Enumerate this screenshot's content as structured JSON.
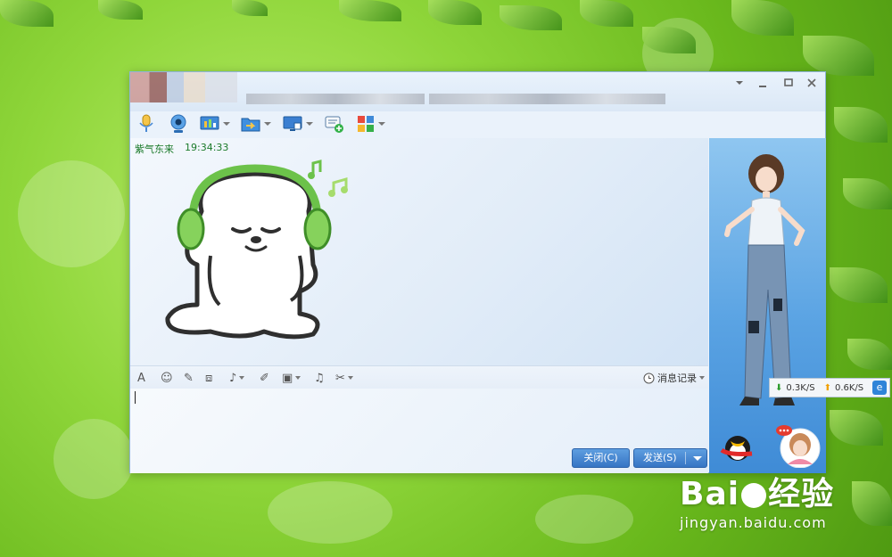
{
  "desktop": {
    "watermark_logo": "Bai",
    "watermark_logo_suffix": "经验",
    "watermark_url": "jingyan.baidu.com"
  },
  "window": {
    "title": "",
    "controls": [
      "menu",
      "minimize",
      "maximize",
      "close"
    ]
  },
  "toolbar": {
    "items": [
      {
        "name": "voice-call",
        "icon": "microphone-icon",
        "has_dropdown": false
      },
      {
        "name": "video-call",
        "icon": "webcam-icon",
        "has_dropdown": false
      },
      {
        "name": "remote-assist",
        "icon": "screen-share-icon",
        "has_dropdown": true
      },
      {
        "name": "send-file",
        "icon": "folder-transfer-icon",
        "has_dropdown": true
      },
      {
        "name": "remote-desktop",
        "icon": "remote-desktop-icon",
        "has_dropdown": true
      },
      {
        "name": "create-discussion",
        "icon": "chat-add-icon",
        "has_dropdown": false
      },
      {
        "name": "apps",
        "icon": "app-grid-icon",
        "has_dropdown": true
      }
    ]
  },
  "chat": {
    "messages": [
      {
        "sender": "紫气东来",
        "time": "19:34:33",
        "content_type": "sticker",
        "sticker": "dog-with-headphones"
      }
    ]
  },
  "format_bar": {
    "items": [
      {
        "name": "font",
        "glyph": "A",
        "icon": "font-icon",
        "has_dropdown": false
      },
      {
        "name": "emoji",
        "glyph": "☺",
        "icon": "smiley-icon",
        "has_dropdown": false
      },
      {
        "name": "magic-emoji",
        "glyph": "✎",
        "icon": "wand-icon",
        "has_dropdown": false
      },
      {
        "name": "shake",
        "glyph": "⧈",
        "icon": "shake-icon",
        "has_dropdown": false
      },
      {
        "name": "voice-message",
        "glyph": "♪",
        "icon": "mic-small-icon",
        "has_dropdown": true
      },
      {
        "name": "note",
        "glyph": "✐",
        "icon": "edit-icon",
        "has_dropdown": false
      },
      {
        "name": "image",
        "glyph": "▣",
        "icon": "image-icon",
        "has_dropdown": true
      },
      {
        "name": "music",
        "glyph": "♫",
        "icon": "music-icon",
        "has_dropdown": false
      },
      {
        "name": "screenshot",
        "glyph": "✂",
        "icon": "scissors-icon",
        "has_dropdown": true
      }
    ],
    "history_label": "消息记录"
  },
  "input": {
    "value": ""
  },
  "buttons": {
    "close_label": "关闭(C)",
    "send_label": "发送(S)"
  },
  "side_panel": {
    "network": {
      "down": "0.3K/S",
      "up": "0.6K/S",
      "ie_label": "e"
    }
  },
  "colors": {
    "accent": "#3675c4",
    "sender": "#1b7a2a",
    "side_bg": "#5aa3e3"
  }
}
